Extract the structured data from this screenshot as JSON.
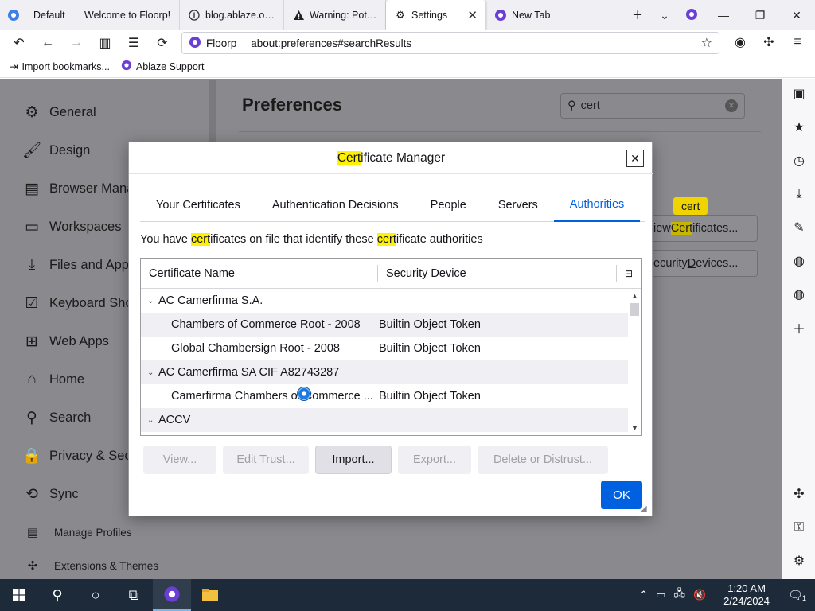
{
  "browser": {
    "tabs": [
      {
        "label": "Default",
        "icon": "floorp-icon"
      },
      {
        "label": "Welcome to Floorp!",
        "icon": "blank-icon"
      },
      {
        "label": "blog.ablaze.one",
        "icon": "info-icon"
      },
      {
        "label": "Warning: Potenti",
        "icon": "warning-icon"
      },
      {
        "label": "Settings",
        "icon": "gear-icon",
        "active": true
      },
      {
        "label": "New Tab",
        "icon": "floorp-icon"
      }
    ],
    "url_brand": "Floorp",
    "url": "about:preferences#searchResults",
    "bookmarks": [
      {
        "label": "Import bookmarks...",
        "icon": "import-icon"
      },
      {
        "label": "Ablaze Support",
        "icon": "floorp-icon"
      }
    ]
  },
  "preferences": {
    "title": "Preferences",
    "search_value": "cert",
    "nav": [
      {
        "label": "General",
        "icon": "gear-icon"
      },
      {
        "label": "Design",
        "icon": "brush-icon"
      },
      {
        "label": "Browser Mana",
        "icon": "sidebar-icon"
      },
      {
        "label": "Workspaces",
        "icon": "workspaces-icon"
      },
      {
        "label": "Files and Appl",
        "icon": "download-icon"
      },
      {
        "label": "Keyboard Sho",
        "icon": "checkbox-icon"
      },
      {
        "label": "Web Apps",
        "icon": "webapps-icon"
      },
      {
        "label": "Home",
        "icon": "home-icon"
      },
      {
        "label": "Search",
        "icon": "search-icon"
      },
      {
        "label": "Privacy & Secu",
        "icon": "lock-icon"
      },
      {
        "label": "Sync",
        "icon": "sync-icon"
      }
    ],
    "nav_small": [
      {
        "label": "Manage Profiles",
        "icon": "profiles-icon"
      },
      {
        "label": "Extensions & Themes",
        "icon": "puzzle-icon"
      }
    ],
    "view_certificates_pre": "iew ",
    "view_certificates_hl": "Cert",
    "view_certificates_post": "ificates...",
    "security_devices_pre": "ecurity ",
    "security_devices_ul": "D",
    "security_devices_post": "evices...",
    "cert_tooltip": "cert"
  },
  "dialog": {
    "title_hl": "Cert",
    "title_rest": "ificate Manager",
    "tabs": [
      "Your Certificates",
      "Authentication Decisions",
      "People",
      "Servers",
      "Authorities"
    ],
    "active_tab": "Authorities",
    "desc_1": "You have ",
    "desc_hl1": "cert",
    "desc_2": "ificates on file that identify these ",
    "desc_hl2": "cert",
    "desc_3": "ificate authorities",
    "columns": [
      "Certificate Name",
      "Security Device"
    ],
    "rows": [
      {
        "type": "group",
        "name": "AC Camerfirma S.A."
      },
      {
        "type": "child",
        "name": "Chambers of Commerce Root - 2008",
        "device": "Builtin Object Token"
      },
      {
        "type": "child",
        "name": "Global Chambersign Root - 2008",
        "device": "Builtin Object Token"
      },
      {
        "type": "group",
        "name": "AC Camerfirma SA CIF A82743287"
      },
      {
        "type": "child",
        "name": "Camerfirma Chambers of Commerce ...",
        "device": "Builtin Object Token"
      },
      {
        "type": "group",
        "name": "ACCV"
      }
    ],
    "buttons": {
      "view": "View...",
      "edit_trust": "Edit Trust...",
      "import": "Import...",
      "export": "Export...",
      "delete": "Delete or Distrust...",
      "ok": "OK"
    }
  },
  "taskbar": {
    "time": "1:20 AM",
    "date": "2/24/2024",
    "notification_count": "1"
  },
  "colors": {
    "accent": "#0061e0",
    "highlight": "#fff200",
    "taskbar": "#1c2a3a"
  }
}
